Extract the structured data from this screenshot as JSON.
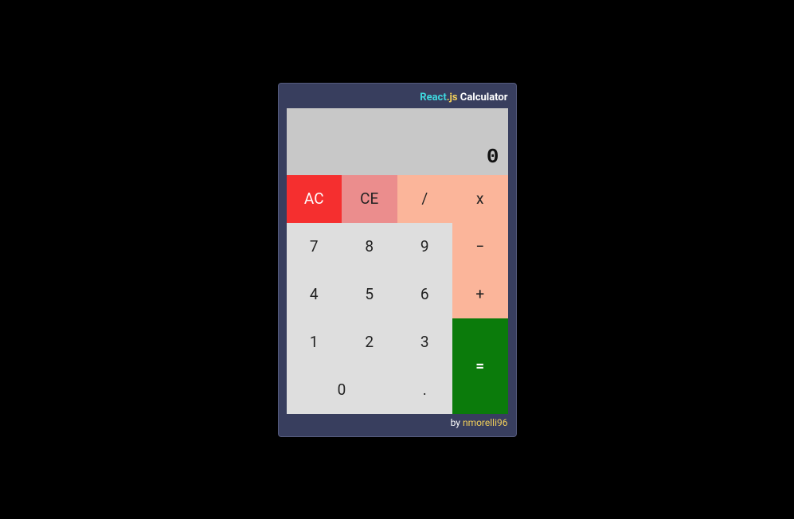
{
  "title": {
    "react": "React",
    "dotjs": ".js",
    "calc": " Calculator"
  },
  "display": {
    "value": "0"
  },
  "buttons": {
    "ac": "AC",
    "ce": "CE",
    "divide": "/",
    "multiply": "x",
    "seven": "7",
    "eight": "8",
    "nine": "9",
    "subtract": "−",
    "four": "4",
    "five": "5",
    "six": "6",
    "add": "+",
    "one": "1",
    "two": "2",
    "three": "3",
    "equals": "=",
    "zero": "0",
    "decimal": "."
  },
  "footer": {
    "by": "by ",
    "author": "nmorelli96"
  }
}
